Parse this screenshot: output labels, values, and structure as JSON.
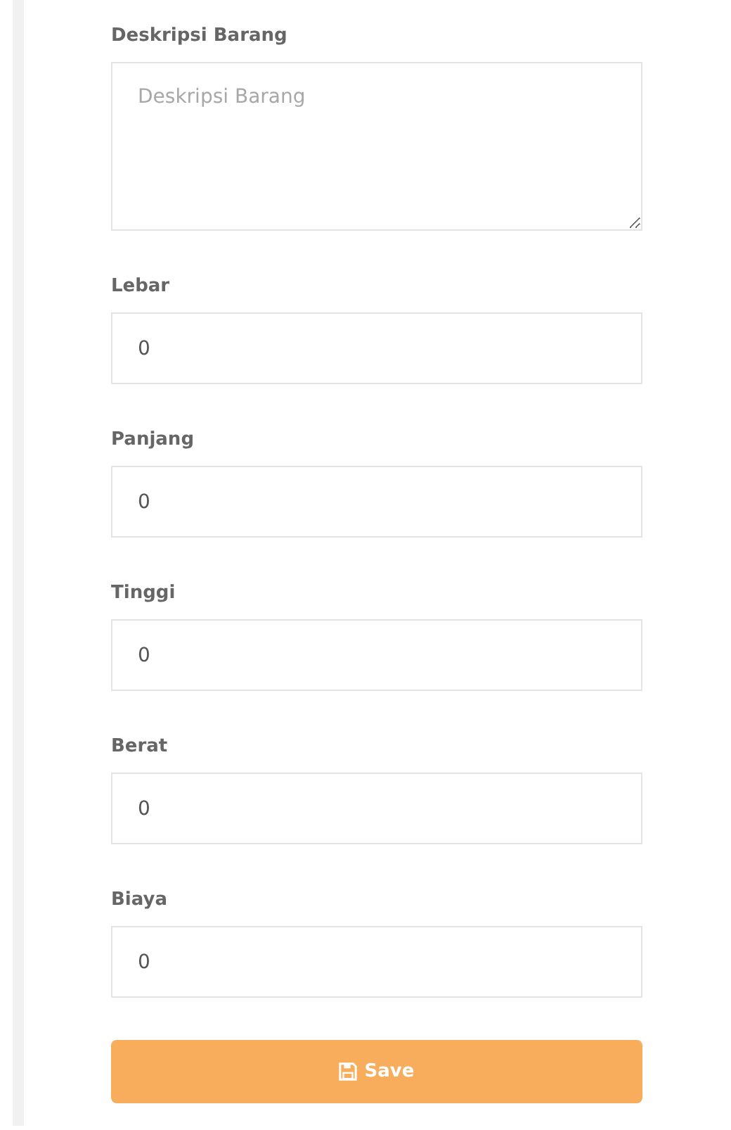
{
  "fields": [
    {
      "label": "Deskripsi Barang",
      "kind": "textarea",
      "placeholder": "Deskripsi Barang"
    },
    {
      "label": "Lebar",
      "kind": "input",
      "value": "0"
    },
    {
      "label": "Panjang",
      "kind": "input",
      "value": "0"
    },
    {
      "label": "Tinggi",
      "kind": "input",
      "value": "0"
    },
    {
      "label": "Berat",
      "kind": "input",
      "value": "0"
    },
    {
      "label": "Biaya",
      "kind": "input",
      "value": "0"
    }
  ],
  "save_button": {
    "label": "Save"
  }
}
